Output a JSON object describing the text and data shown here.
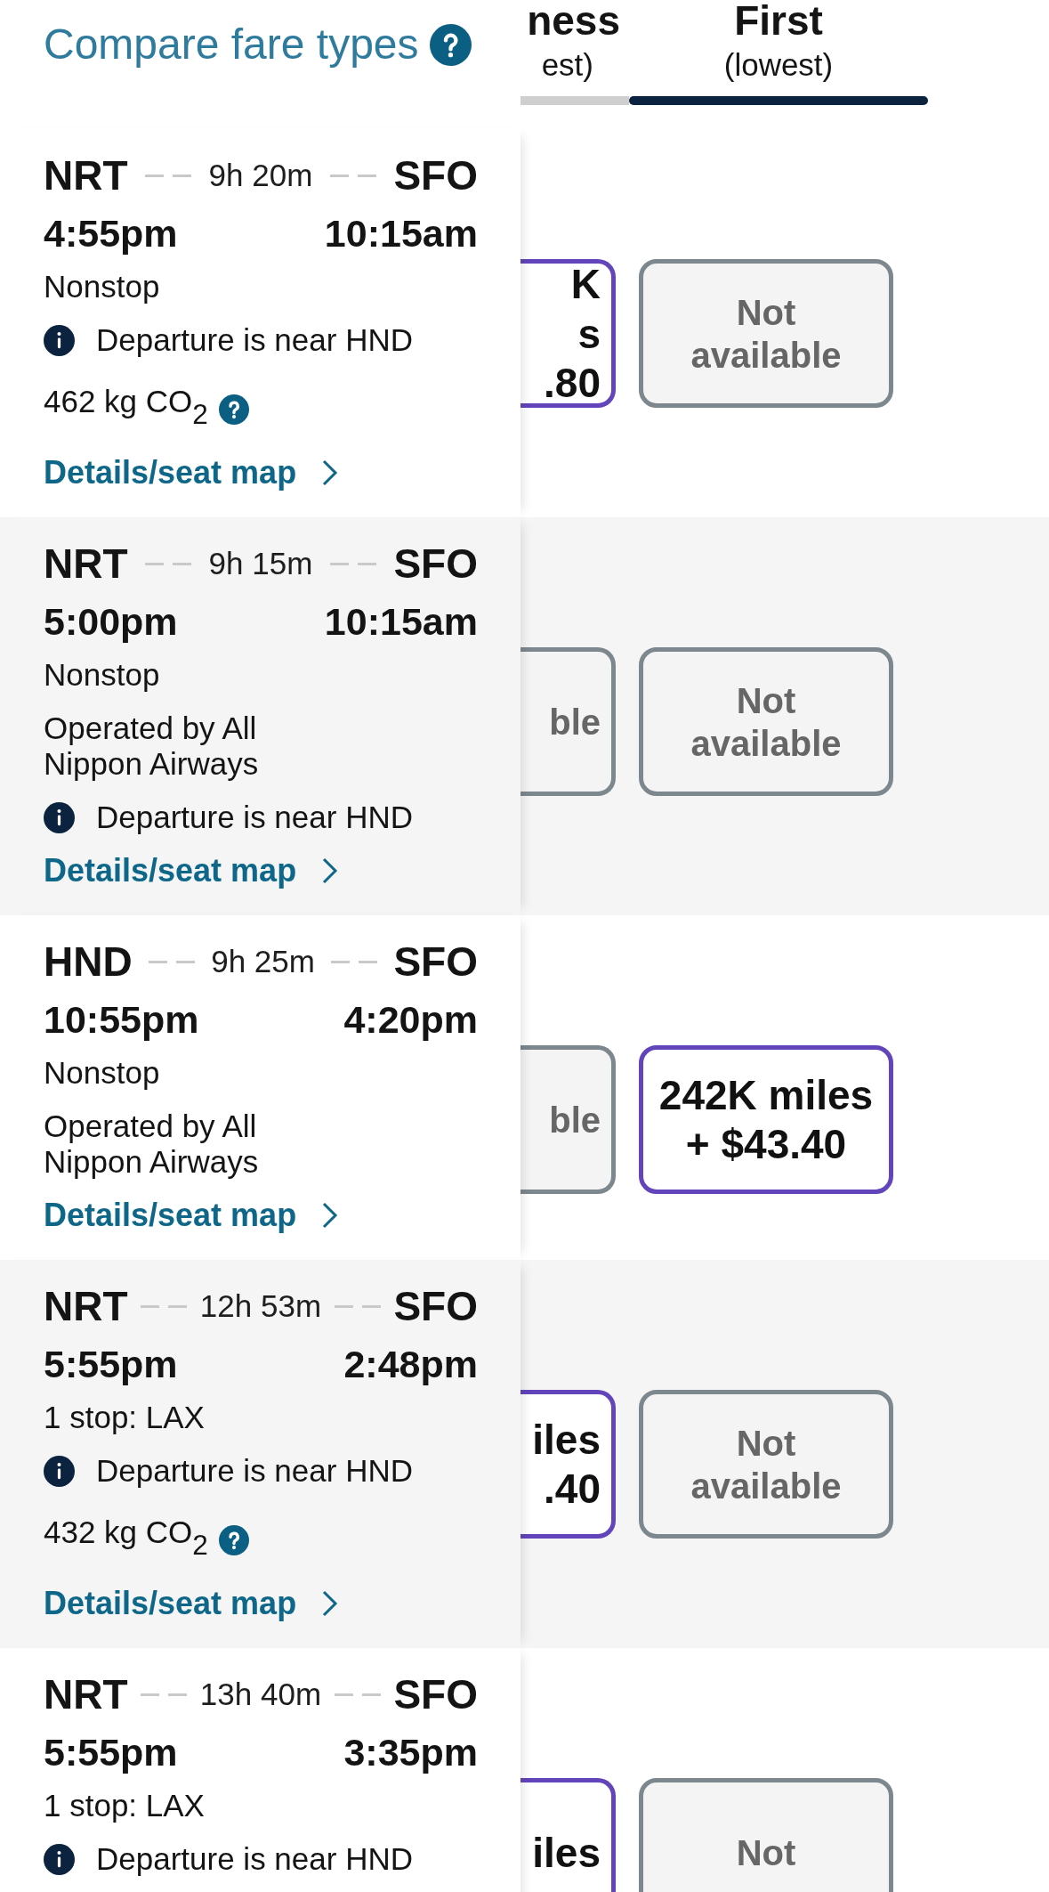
{
  "header": {
    "title": "Compare fare types",
    "columns": [
      {
        "name": "ness",
        "note": "est)",
        "selected": false
      },
      {
        "name": "First",
        "note": "(lowest)",
        "selected": true
      }
    ]
  },
  "flights": [
    {
      "origin": "NRT",
      "duration": "9h 20m",
      "destination": "SFO",
      "depart": "4:55pm",
      "arrive": "10:15am",
      "stops": "Nonstop",
      "notice": "Departure is near HND",
      "co2": "462 kg CO$_{2}$",
      "details_link": "Details/seat map",
      "fares": [
        {
          "kind": "award",
          "lines": [
            "K",
            "s",
            ".80"
          ]
        },
        {
          "kind": "unavailable",
          "lines": [
            "Not",
            "available"
          ]
        }
      ]
    },
    {
      "origin": "NRT",
      "duration": "9h 15m",
      "destination": "SFO",
      "depart": "5:00pm",
      "arrive": "10:15am",
      "stops": "Nonstop",
      "operator": "Operated by All Nippon Airways",
      "notice": "Departure is near HND",
      "details_link": "Details/seat map",
      "fares": [
        {
          "kind": "unavailable",
          "lines": [
            "ble"
          ]
        },
        {
          "kind": "unavailable",
          "lines": [
            "Not",
            "available"
          ]
        }
      ]
    },
    {
      "origin": "HND",
      "duration": "9h 25m",
      "destination": "SFO",
      "depart": "10:55pm",
      "arrive": "4:20pm",
      "stops": "Nonstop",
      "operator": "Operated by All Nippon Airways",
      "details_link": "Details/seat map",
      "fares": [
        {
          "kind": "unavailable",
          "lines": [
            "ble"
          ]
        },
        {
          "kind": "award",
          "lines": [
            "242K miles",
            "+ $43.40"
          ]
        }
      ]
    },
    {
      "origin": "NRT",
      "duration": "12h 53m",
      "destination": "SFO",
      "depart": "5:55pm",
      "arrive": "2:48pm",
      "stops": "1 stop: LAX",
      "notice": "Departure is near HND",
      "co2": "432 kg CO$_{2}$",
      "details_link": "Details/seat map",
      "fares": [
        {
          "kind": "award",
          "lines": [
            "iles",
            ".40"
          ]
        },
        {
          "kind": "unavailable",
          "lines": [
            "Not",
            "available"
          ]
        }
      ]
    },
    {
      "origin": "NRT",
      "duration": "13h 40m",
      "destination": "SFO",
      "depart": "5:55pm",
      "arrive": "3:35pm",
      "stops": "1 stop: LAX",
      "notice": "Departure is near HND",
      "fares": [
        {
          "kind": "award",
          "lines": [
            "iles"
          ]
        },
        {
          "kind": "unavailable",
          "lines": [
            "Not"
          ]
        }
      ]
    }
  ]
}
